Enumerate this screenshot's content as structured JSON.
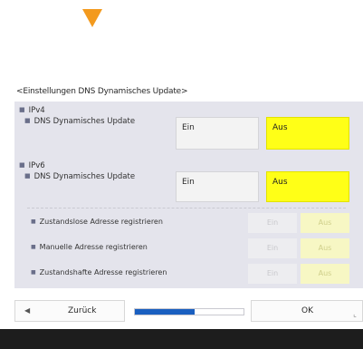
{
  "heading": "<Einstellungen DNS Dynamisches Update>",
  "ipv4": {
    "section_label": "IPv4",
    "row_label": "DNS Dynamisches Update",
    "on_label": "Ein",
    "off_label": "Aus",
    "selected": "Aus"
  },
  "ipv6": {
    "section_label": "IPv6",
    "row_label": "DNS Dynamisches Update",
    "on_label": "Ein",
    "off_label": "Aus",
    "selected": "Aus",
    "sub_rows": [
      {
        "label": "Zustandslose Adresse registrieren",
        "on_label": "Ein",
        "off_label": "Aus",
        "selected": "Aus",
        "enabled": false
      },
      {
        "label": "Manuelle Adresse registrieren",
        "on_label": "Ein",
        "off_label": "Aus",
        "selected": "Aus",
        "enabled": false
      },
      {
        "label": "Zustandshafte Adresse registrieren",
        "on_label": "Ein",
        "off_label": "Aus",
        "selected": "Aus",
        "enabled": false
      }
    ]
  },
  "bottom": {
    "back_label": "Zurück",
    "ok_label": "OK",
    "progress": 0.55
  },
  "colors": {
    "arrow": "#f39a1e",
    "selected": "#ffff17",
    "progress": "#1a5fc0"
  }
}
